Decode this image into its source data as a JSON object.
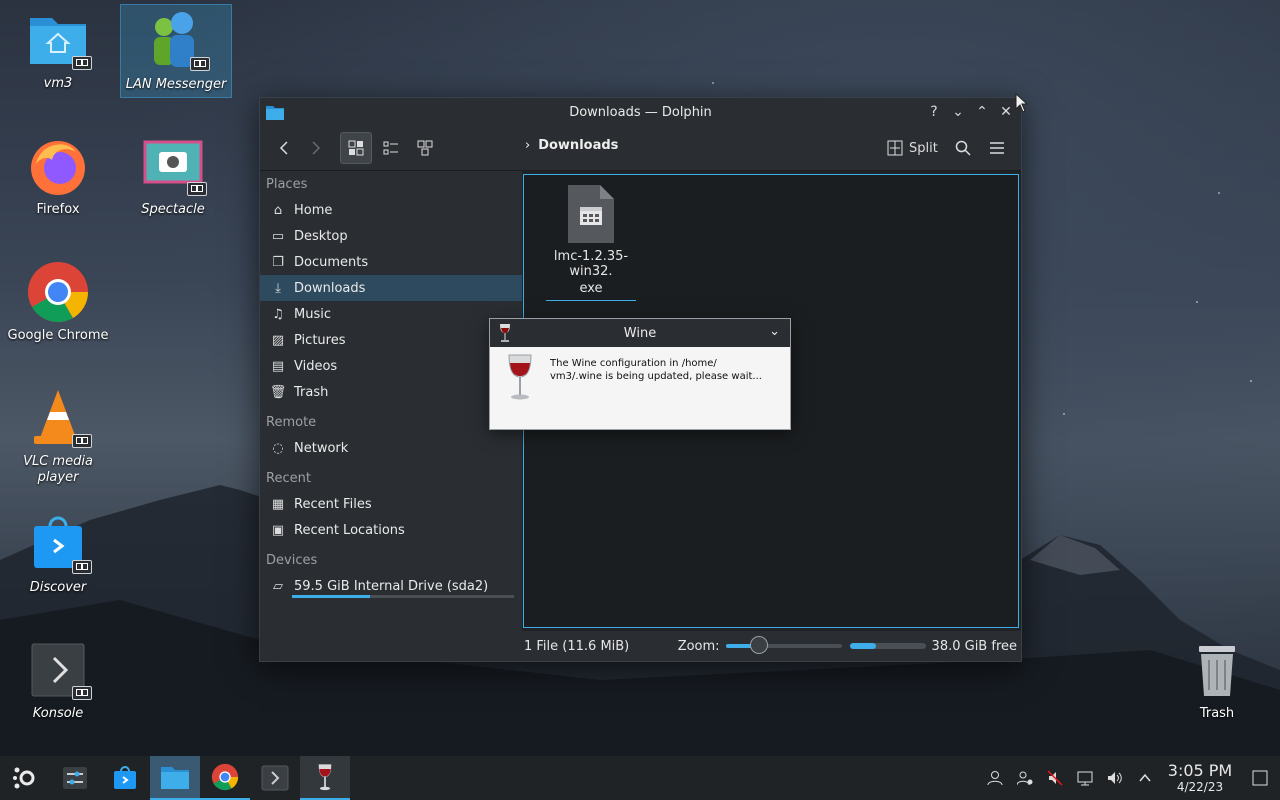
{
  "desktop": {
    "icons": [
      {
        "label": "vm3",
        "italic": true
      },
      {
        "label": "LAN Messenger",
        "italic": true
      },
      {
        "label": "Firefox",
        "italic": false
      },
      {
        "label": "Spectacle",
        "italic": true
      },
      {
        "label": "Google Chrome",
        "italic": false
      },
      {
        "label": "VLC media player",
        "italic": true
      },
      {
        "label": "Discover",
        "italic": true
      },
      {
        "label": "Konsole",
        "italic": true
      },
      {
        "label": "Trash",
        "italic": false
      }
    ]
  },
  "dolphin": {
    "title": "Downloads — Dolphin",
    "breadcrumb": "Downloads",
    "split_label": "Split",
    "sidebar": {
      "places_header": "Places",
      "places": [
        {
          "label": "Home",
          "icon": "home-icon"
        },
        {
          "label": "Desktop",
          "icon": "desktop-icon"
        },
        {
          "label": "Documents",
          "icon": "documents-icon"
        },
        {
          "label": "Downloads",
          "icon": "downloads-icon"
        },
        {
          "label": "Music",
          "icon": "music-icon"
        },
        {
          "label": "Pictures",
          "icon": "pictures-icon"
        },
        {
          "label": "Videos",
          "icon": "videos-icon"
        },
        {
          "label": "Trash",
          "icon": "trash-icon"
        }
      ],
      "remote_header": "Remote",
      "remote": [
        {
          "label": "Network",
          "icon": "network-icon"
        }
      ],
      "recent_header": "Recent",
      "recent": [
        {
          "label": "Recent Files",
          "icon": "recent-files-icon"
        },
        {
          "label": "Recent Locations",
          "icon": "recent-locations-icon"
        }
      ],
      "devices_header": "Devices",
      "devices": [
        {
          "label": "59.5 GiB Internal Drive (sda2)",
          "icon": "drive-icon",
          "used_fraction": 0.35
        }
      ]
    },
    "files": [
      {
        "name_line1": "lmc-1.2.35-win32.",
        "name_line2": "exe",
        "icon": "exe-file-icon"
      }
    ],
    "status": {
      "summary": "1 File (11.6 MiB)",
      "zoom_label": "Zoom:",
      "zoom_fraction": 0.28,
      "free_fraction": 0.35,
      "free_label": "38.0 GiB free"
    }
  },
  "wine_dialog": {
    "title": "Wine",
    "message_line1": "The Wine configuration in /home/",
    "message_line2": "vm3/.wine is being updated, please wait..."
  },
  "taskbar": {
    "clock_time": "3:05 PM",
    "clock_date": "4/22/23"
  },
  "colors": {
    "accent": "#3daee9",
    "window_bg": "#202326",
    "panel_bg": "#2a2e32"
  }
}
